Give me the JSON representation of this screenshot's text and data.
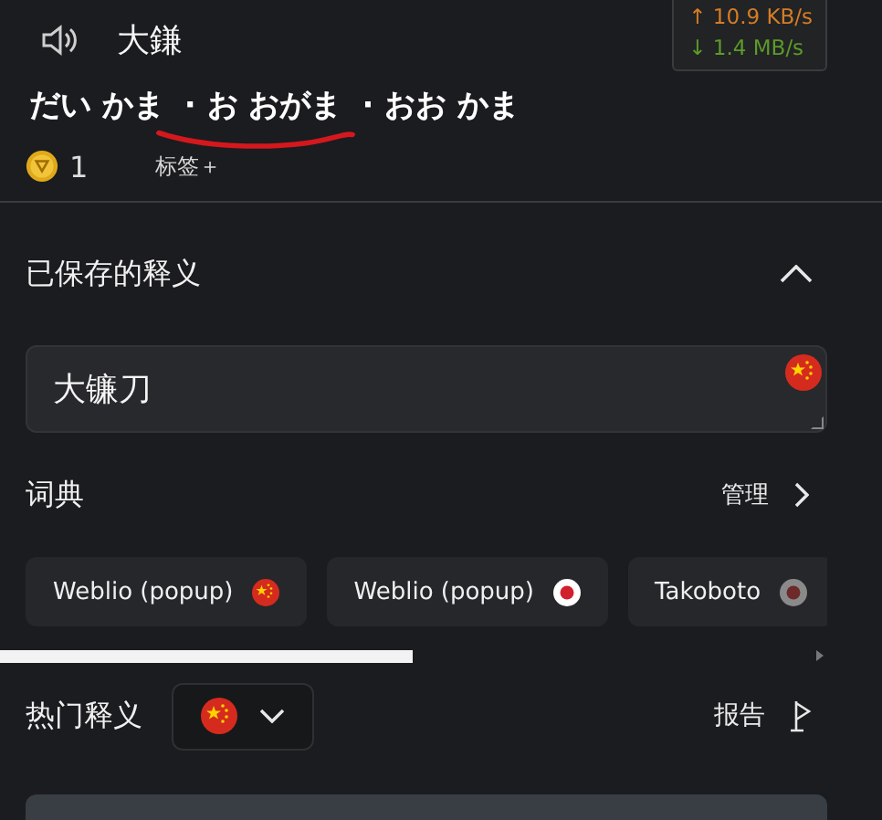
{
  "header": {
    "word": "大鎌",
    "network": {
      "upload": "↑ 10.9 KB/s",
      "download": "↓ 1.4 MB/s"
    }
  },
  "readings": [
    {
      "text": "だい かま",
      "underlined": false
    },
    {
      "text": "· お おがま",
      "underlined": true
    },
    {
      "text": "· おお かま",
      "underlined": false
    }
  ],
  "meta": {
    "coins": "1",
    "tag_button": "标签＋"
  },
  "saved_definitions": {
    "title": "已保存的释义",
    "expanded": true,
    "value": "大镰刀",
    "flag": {
      "kind": "cn"
    }
  },
  "dictionaries": {
    "title": "词典",
    "manage": "管理",
    "items": [
      {
        "label": "Weblio (popup)",
        "flag": {
          "kind": "cn"
        }
      },
      {
        "label": "Weblio (popup)",
        "flag": {
          "kind": "jp"
        }
      },
      {
        "label": "Takoboto",
        "flag": {
          "kind": "grey"
        }
      }
    ]
  },
  "popular_definitions": {
    "title": "热门释义",
    "language_flag": {
      "kind": "cn"
    },
    "report": "报告"
  }
}
